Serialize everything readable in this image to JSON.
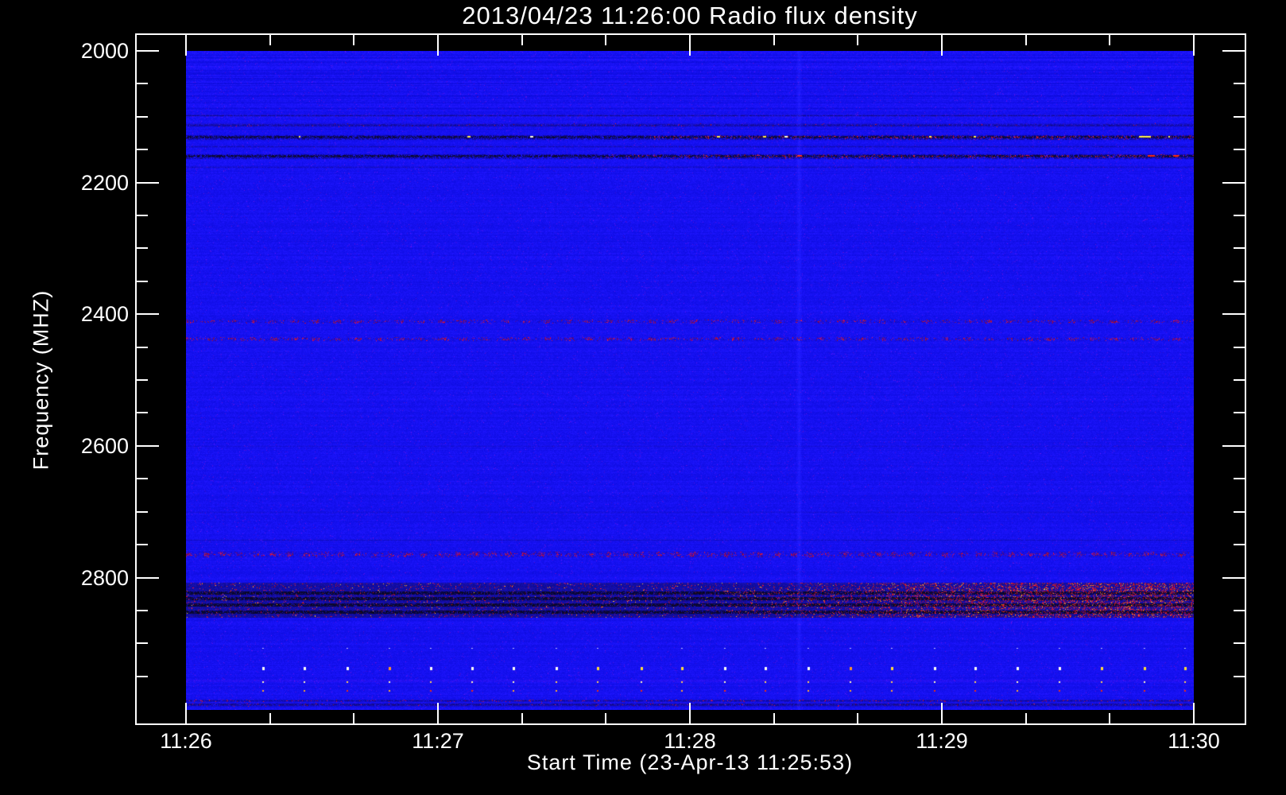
{
  "chart_data": {
    "type": "heatmap",
    "title": "2013/04/23 11:26:00 Radio flux density",
    "xlabel": "Start Time (23-Apr-13 11:25:53)",
    "ylabel": "Frequency (MHZ)",
    "x_ticks": [
      "11:26",
      "11:27",
      "11:28",
      "11:29",
      "11:30"
    ],
    "x_tick_seconds": [
      0,
      60,
      120,
      180,
      240
    ],
    "x_span_s": 240,
    "x_major_s": 60,
    "x_minor_s": 20,
    "y_ticks": [
      2000,
      2200,
      2400,
      2600,
      2800
    ],
    "y_minor_mhz": 50,
    "y_range": [
      2000,
      3001
    ],
    "legend": "none",
    "grid": "off",
    "palette": {
      "background": "#000000",
      "axis": "#ffffff",
      "text": "#ffffff",
      "base_blue": "#1410f0",
      "dark_band": "#05051e",
      "red_speckle": "#c81400",
      "orange": "#ff8c1e",
      "yellow": "#ffe650",
      "white_dot": "#ffffff"
    },
    "features": [
      {
        "kind": "noisy_row",
        "f": 2098,
        "h": 3,
        "darken": 0.45
      },
      {
        "kind": "noisy_row",
        "f": 2112,
        "h": 4,
        "darken": 0.5,
        "red": 0.08
      },
      {
        "kind": "active_row",
        "f": 2131,
        "h": 6,
        "red_after_s": 110,
        "bright_dots": 9,
        "streaks": [
          {
            "t": 227,
            "len_s": 2.5,
            "color": "yellow"
          }
        ]
      },
      {
        "kind": "noisy_row",
        "f": 2145,
        "h": 3,
        "darken": 0.3
      },
      {
        "kind": "active_row",
        "f": 2159,
        "h": 7,
        "red_after_s": 100,
        "bright_dots": 0,
        "streaks": [
          {
            "t": 145.5,
            "len_s": 1,
            "color": "red"
          },
          {
            "t": 229,
            "len_s": 1.5,
            "color": "red"
          },
          {
            "t": 235,
            "len_s": 1.2,
            "color": "red"
          }
        ]
      },
      {
        "kind": "noisy_row",
        "f": 2176,
        "h": 3,
        "darken": 0.25
      },
      {
        "kind": "dotted_row",
        "f": 2410,
        "h": 4,
        "density": 0.22,
        "clump_period_s": 5
      },
      {
        "kind": "dotted_row",
        "f": 2437,
        "h": 5,
        "density": 0.25,
        "clump_period_s": 5
      },
      {
        "kind": "noisy_row",
        "f": 2600,
        "h": 2,
        "darken": 0.12
      },
      {
        "kind": "noisy_row",
        "f": 2700,
        "h": 2,
        "darken": 0.12
      },
      {
        "kind": "noisy_row",
        "f": 2742,
        "h": 3,
        "darken": 0.2
      },
      {
        "kind": "dotted_row",
        "f": 2764,
        "h": 6,
        "density": 0.3,
        "clump_period_s": 4
      },
      {
        "kind": "strong_band",
        "f1": 2808,
        "f2": 2860,
        "stripes": [
          2822,
          2831,
          2841,
          2851
        ],
        "red_onset_s": 128,
        "red_max": 0.34
      },
      {
        "kind": "tint_row",
        "f": 2956,
        "amount": 22
      },
      {
        "kind": "noisy_row",
        "f": 2986,
        "h": 3,
        "darken": 0.5,
        "red": 0.5
      },
      {
        "kind": "noisy_row",
        "f": 2992,
        "h": 4,
        "darken": 0.6,
        "red": 0.15
      },
      {
        "kind": "cal_pulses",
        "start_s": 18,
        "period_s": 10,
        "rows": [
          {
            "f": 2907,
            "style": "faint"
          },
          {
            "f": 2937,
            "style": "bright"
          },
          {
            "f": 2957,
            "style": "medium"
          },
          {
            "f": 2971,
            "style": "red"
          }
        ]
      },
      {
        "kind": "vstreak",
        "t": 146,
        "w": 7,
        "lighten": 0.5
      }
    ]
  }
}
